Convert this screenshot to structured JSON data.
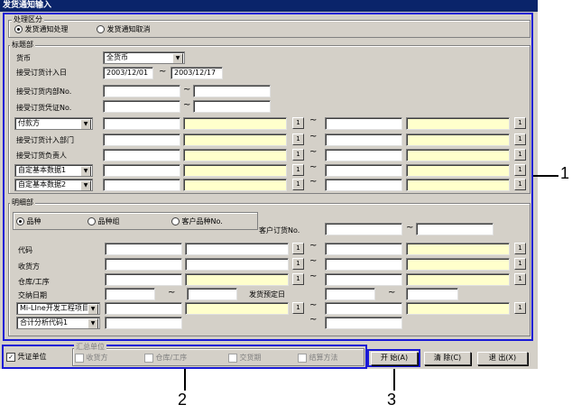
{
  "window": {
    "title": "发货通知输入"
  },
  "process_section": {
    "title": "处理区分",
    "options": [
      {
        "label": "发货通知处理",
        "checked": true
      },
      {
        "label": "发货通知取消",
        "checked": false
      }
    ]
  },
  "header_section": {
    "title": "标题部",
    "currency": {
      "label": "货币",
      "value": "全货币"
    },
    "order_date": {
      "label": "接受订货计入日",
      "from": "2003/12/01",
      "to": "2003/12/17"
    },
    "internal_no": {
      "label": "接受订货内部No."
    },
    "voucher_no": {
      "label": "接受订货凭证No."
    },
    "payer": {
      "value": "付款方"
    },
    "dept": {
      "label": "接受订货计入部门"
    },
    "manager": {
      "label": "接受订货负责人"
    },
    "custom1": {
      "value": "自定基本数据1"
    },
    "custom2": {
      "value": "自定基本数据2"
    }
  },
  "detail_section": {
    "title": "明细部",
    "radios": [
      {
        "label": "品种",
        "checked": true
      },
      {
        "label": "品种组",
        "checked": false
      },
      {
        "label": "客户品种No.",
        "checked": false
      }
    ],
    "customer_order_no": {
      "label": "客户订货No."
    },
    "code": {
      "label": "代码"
    },
    "consignee": {
      "label": "收货方"
    },
    "warehouse": {
      "label": "仓库/工序"
    },
    "delivery_date": {
      "label": "交纳日期"
    },
    "planned_ship_date": {
      "label": "发货预定日"
    },
    "project": {
      "value": "Mi-LIne开发工程项目"
    },
    "analysis": {
      "value": "合计分析代码1"
    }
  },
  "tilde": "~",
  "ibtn_label": "1",
  "bottom": {
    "voucher_unit": {
      "label": "凭证单位",
      "checked": true
    },
    "unit_group_title": "汇总单位",
    "unit_options": [
      "收货方",
      "仓库/工序",
      "交货期",
      "结算方法"
    ],
    "start_button": "开 始(A)",
    "clear_button": "清 除(C)",
    "exit_button": "退 出(X)"
  },
  "callouts": [
    "1",
    "2",
    "3"
  ],
  "colors": {
    "frame": "#1a1ad6",
    "title_bar": "#0a246a",
    "highlight_field": "#ffffcc",
    "dialog_bg": "#d4d0c8"
  }
}
